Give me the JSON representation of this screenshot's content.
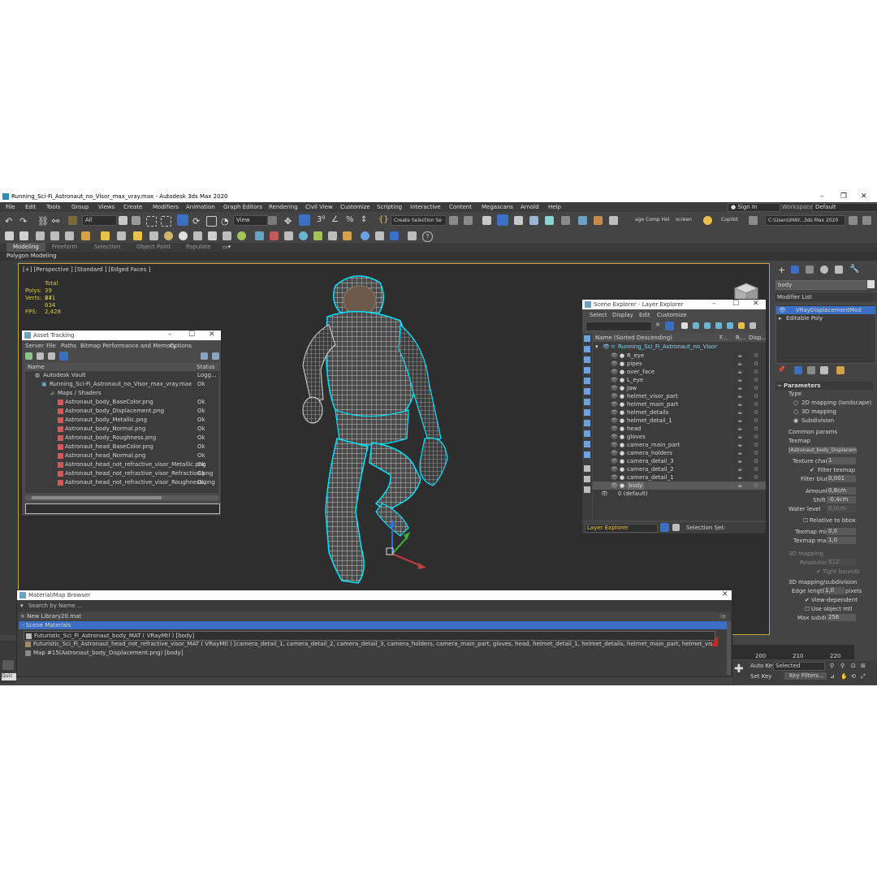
{
  "window": {
    "title": "Running_Sci-Fi_Astronaut_no_Visor_max_vray.max - Autodesk 3ds Max 2020"
  },
  "menu": [
    "File",
    "Edit",
    "Tools",
    "Group",
    "Views",
    "Create",
    "Modifiers",
    "Animation",
    "Graph Editors",
    "Rendering",
    "Civil View",
    "Customize",
    "Scripting",
    "Interactive",
    "Content",
    "Megascans",
    "Arnold",
    "Help"
  ],
  "signin": "Sign In",
  "workspaces_label": "Workspaces:",
  "workspaces_value": "Default",
  "toolbar": {
    "filter_all": "All",
    "view_dropdown": "View",
    "selection_set": "Create Selection Se",
    "comp_help": "age Comp Hel",
    "screen": "screen",
    "copilot": "Copilot",
    "project_path": "C:\\Users\\MAY...3ds Max 2020"
  },
  "ribbon": {
    "tabs": [
      "Modeling",
      "Freeform",
      "Selection",
      "Object Paint",
      "Populate"
    ],
    "active": "Modeling",
    "subtitle": "Polygon Modeling"
  },
  "viewport": {
    "label": "[+] [Perspective ] [Standard ] [Edged Faces ]",
    "stats": {
      "total_label": "Total",
      "polys_label": "Polys:",
      "polys": "39 871",
      "verts_label": "Verts:",
      "verts": "24 634",
      "fps_label": "FPS:",
      "fps": "2,428"
    }
  },
  "asset_tracking": {
    "title": "Asset Tracking",
    "menu": [
      "Server",
      "File",
      "Paths",
      "Bitmap Performance and Memory",
      "Options"
    ],
    "col_name": "Name",
    "col_status": "Status",
    "rows": [
      {
        "name": "Autodesk Vault",
        "status": "Logg..."
      },
      {
        "name": "Running_Sci-Fi_Astronaut_no_Visor_max_vray.max",
        "status": "Ok"
      },
      {
        "name": "Maps / Shaders",
        "status": ""
      },
      {
        "name": "Astronaut_body_BaseColor.png",
        "status": "Ok"
      },
      {
        "name": "Astronaut_body_Displacement.png",
        "status": "Ok"
      },
      {
        "name": "Astronaut_body_Metallic.png",
        "status": "Ok"
      },
      {
        "name": "Astronaut_body_Normal.png",
        "status": "Ok"
      },
      {
        "name": "Astronaut_body_Roughness.png",
        "status": "Ok"
      },
      {
        "name": "Astronaut_head_BaseColor.png",
        "status": "Ok"
      },
      {
        "name": "Astronaut_head_Normal.png",
        "status": "Ok"
      },
      {
        "name": "Astronaut_head_not_refractive_visor_Metallic.png",
        "status": "Ok"
      },
      {
        "name": "Astronaut_head_not_refractive_visor_Refraction.png",
        "status": "Ok"
      },
      {
        "name": "Astronaut_head_not_refractive_visor_Roughness.png",
        "status": "Ok"
      }
    ]
  },
  "scene_explorer": {
    "title": "Scene Explorer - Layer Explorer",
    "menu": [
      "Select",
      "Display",
      "Edit",
      "Customize"
    ],
    "col_name": "Name (Sorted Descending)",
    "col_f": "F...",
    "col_r": "R...",
    "col_disp": "Disp...",
    "root": "Running_Sci_Fi_Astronaut_no_Visor",
    "items": [
      "R_eye",
      "pipes",
      "over_face",
      "L_eye",
      "Jaw",
      "helmet_visor_part",
      "helmet_main_part",
      "helmet_details",
      "helmet_detail_1",
      "head",
      "gloves",
      "camera_main_part",
      "camera_holders",
      "camera_detail_3",
      "camera_detail_2",
      "camera_detail_1",
      "body"
    ],
    "default_layer": "0 (default)",
    "footer_dropdown": "Layer Explorer",
    "selection_set": "Selection Set:"
  },
  "command_panel": {
    "object_name": "body",
    "modifier_list": "Modifier List",
    "stack": [
      "VRayDisplacementMod",
      "Editable Poly"
    ],
    "parameters": "Parameters",
    "type_label": "Type",
    "types": [
      "2D mapping (landscape)",
      "3D mapping",
      "Subdivision"
    ],
    "common_params": "Common params",
    "texmap_label": "Texmap",
    "texmap_value": "(Astronaut_body_Displacem",
    "texture_chan_label": "Texture chan",
    "texture_chan": "1",
    "filter_texmap": "Filter texmap",
    "filter_blur_label": "Filter blur",
    "filter_blur": "0,001",
    "amount_label": "Amount",
    "amount": "0,8cm",
    "shift_label": "Shift",
    "shift": "-0,4cm",
    "water_level_label": "Water level",
    "water_level": "0,0cm",
    "relative_bbox": "Relative to bbox",
    "texmap_min_label": "Texmap min",
    "texmap_min": "0,0",
    "texmap_max_label": "Texmap max",
    "texmap_max": "1,0",
    "mapping_3d": "3D mapping",
    "resolution_label": "Resolution",
    "resolution": "512",
    "tight_bounds": "Tight bounds",
    "mapping_sub": "3D mapping/subdivision",
    "edge_length_label": "Edge length",
    "edge_length": "1,0",
    "pixels": "pixels",
    "view_dependent": "View-dependent",
    "use_object_mtl": "Use object mtl",
    "max_subdivs_label": "Max subdivs",
    "max_subdivs": "256"
  },
  "material_browser": {
    "title": "Material/Map Browser",
    "search_placeholder": "Search by Name ...",
    "library": "+ New Library20.mat",
    "section": "- Scene Materials",
    "items": [
      "Futuristic_Sci_Fi_Astronaut_body_MAT ( VRayMtl ) [body]",
      "Futuristic_Sci_Fi_Astronaut_head_not_refractive_visor_MAT ( VRayMtl ) [camera_detail_1, camera_detail_2, camera_detail_3, camera_holders, camera_main_part, gloves, head, helmet_detail_1, helmet_details, helmet_main_part, helmet_visor_part, Jaw, L_eye, over_face, pipes, R_eye]",
      "Map #15(Astronaut_body_Displacement.png) [body]"
    ]
  },
  "timeline": {
    "ticks": [
      "200",
      "210",
      "220"
    ]
  },
  "status": {
    "auto_key": "Auto Key",
    "selected": "Selected",
    "set_key": "Set Key",
    "key_filters": "Key Filters...",
    "quick": "Quic"
  },
  "colors": {
    "viewport_bg": "#2e2e2e",
    "wire": "#ffffff",
    "selection": "#00e5ff",
    "highlight": "#3b6fc4",
    "stats": "#d8c64a"
  }
}
